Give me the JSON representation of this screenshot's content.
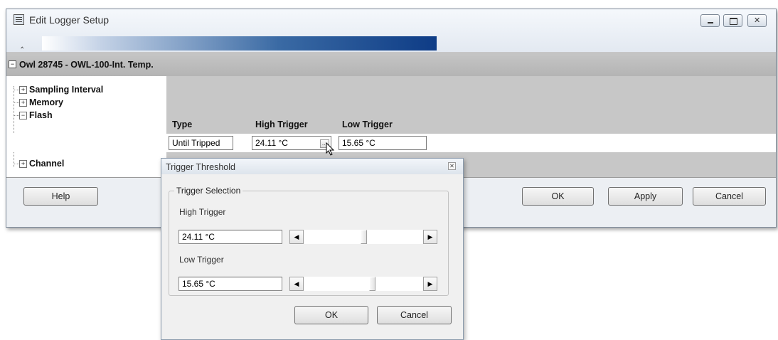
{
  "window": {
    "title": "Edit Logger Setup",
    "header": "Owl 28745 - OWL-100-Int. Temp."
  },
  "tree": {
    "items": [
      {
        "label": "Sampling Interval",
        "toggle": "+"
      },
      {
        "label": "Memory",
        "toggle": "+"
      },
      {
        "label": "Flash",
        "toggle": "−"
      },
      {
        "label": "Channel",
        "toggle": "+"
      }
    ]
  },
  "flash": {
    "columns": [
      "Type",
      "High Trigger",
      "Low Trigger"
    ],
    "type": "Until Tripped",
    "high_trigger": "24.11 °C",
    "low_trigger": "15.65 °C"
  },
  "buttons": {
    "help": "Help",
    "ok": "OK",
    "apply": "Apply",
    "cancel": "Cancel"
  },
  "dialog": {
    "title": "Trigger Threshold",
    "group_label": "Trigger Selection",
    "high_label": "High Trigger",
    "high_value": "24.11 °C",
    "low_label": "Low Trigger",
    "low_value": "15.65 °C",
    "ok": "OK",
    "cancel": "Cancel"
  }
}
